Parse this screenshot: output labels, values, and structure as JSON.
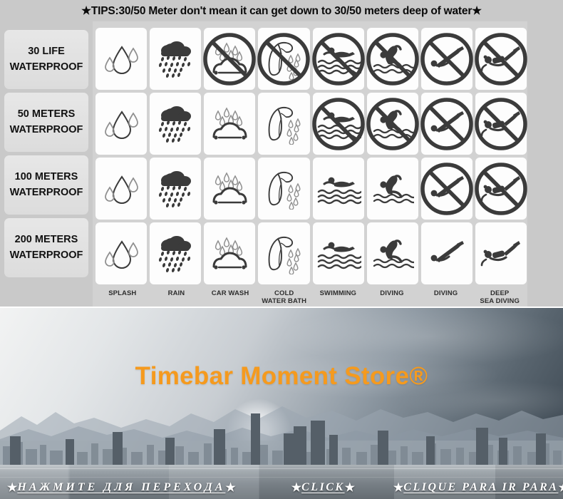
{
  "tips": {
    "text": "★TIPS:30/50 Meter don't mean it can get down to 30/50 meters deep of water★"
  },
  "chart": {
    "row_labels": [
      {
        "line1": "30 LIFE",
        "line2": "WATERPROOF"
      },
      {
        "line1": "50 METERS",
        "line2": "WATERPROOF"
      },
      {
        "line1": "100 METERS",
        "line2": "WATERPROOF"
      },
      {
        "line1": "200 METERS",
        "line2": "WATERPROOF"
      }
    ],
    "col_labels": [
      {
        "line1": "SPLASH",
        "line2": ""
      },
      {
        "line1": "RAIN",
        "line2": ""
      },
      {
        "line1": "CAR WASH",
        "line2": ""
      },
      {
        "line1": "COLD",
        "line2": "WATER BATH"
      },
      {
        "line1": "SWIMMING",
        "line2": ""
      },
      {
        "line1": "DIVING",
        "line2": ""
      },
      {
        "line1": "DIVING",
        "line2": ""
      },
      {
        "line1": "DEEP",
        "line2": "SEA DIVING"
      }
    ],
    "icons": [
      [
        "droplet-icon",
        "rain-cloud-icon",
        "car-wash-icon",
        "shower-icon",
        "swimming-icon",
        "diving-icon",
        "diving-board-icon",
        "deep-sea-diving-icon"
      ],
      [
        "droplet-icon",
        "rain-cloud-icon",
        "car-wash-icon",
        "shower-icon",
        "swimming-icon",
        "diving-icon",
        "diving-board-icon",
        "deep-sea-diving-icon"
      ],
      [
        "droplet-icon",
        "rain-cloud-icon",
        "car-wash-icon",
        "shower-icon",
        "swimming-icon",
        "diving-icon",
        "diving-board-icon",
        "deep-sea-diving-icon"
      ],
      [
        "droplet-icon",
        "rain-cloud-icon",
        "car-wash-icon",
        "shower-icon",
        "swimming-icon",
        "diving-icon",
        "diving-board-icon",
        "deep-sea-diving-icon"
      ]
    ],
    "prohibited": [
      [
        false,
        false,
        true,
        true,
        true,
        true,
        true,
        true
      ],
      [
        false,
        false,
        false,
        false,
        true,
        true,
        true,
        true
      ],
      [
        false,
        false,
        false,
        false,
        false,
        false,
        true,
        true
      ],
      [
        false,
        false,
        false,
        false,
        false,
        false,
        false,
        false
      ]
    ]
  },
  "banner": {
    "store_title": "Timebar Moment Store®",
    "links": [
      {
        "star_left": "★",
        "label": "НАЖМИТЕ ДЛЯ ПЕРЕХОДА",
        "star_right": "★"
      },
      {
        "star_left": "★",
        "label": "CLICK",
        "star_right": "★"
      },
      {
        "star_left": "★",
        "label": "CLIQUE PARA IR PARA",
        "star_right": "★"
      }
    ]
  },
  "colors": {
    "brand_orange": "#f59a1e",
    "chart_bg": "#c9c9c9",
    "cell_bg": "#fdfdfd",
    "icon_dark": "#3b3b3b",
    "icon_light": "#8f8f8f"
  }
}
